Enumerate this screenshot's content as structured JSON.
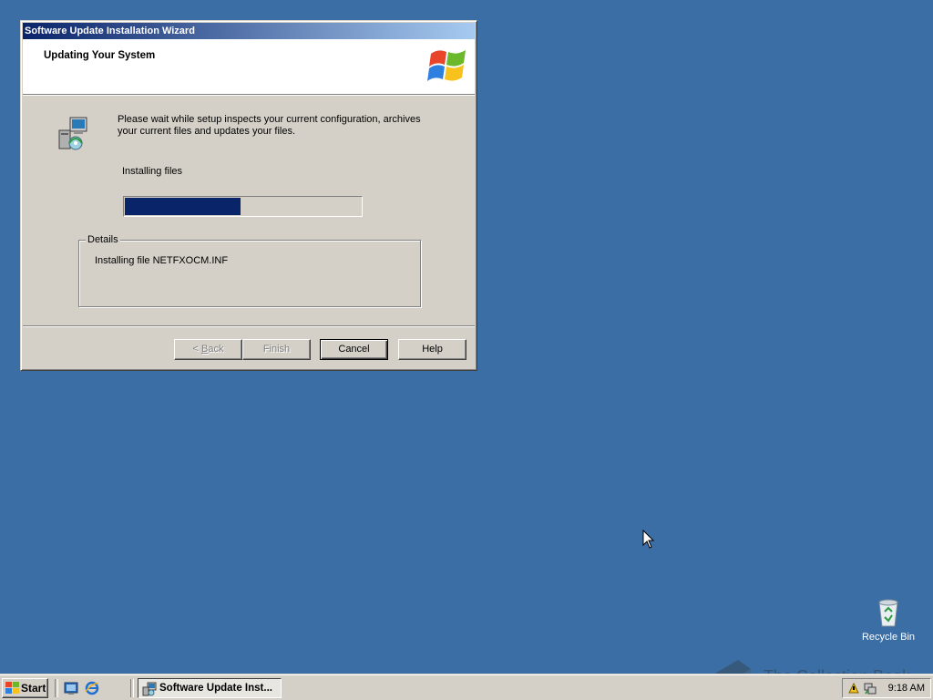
{
  "window": {
    "title": "Software Update Installation Wizard",
    "header_title": "Updating Your System",
    "intro_text": "Please wait while setup inspects your current configuration, archives your current files and updates your files.",
    "status_label": "Installing files",
    "progress_percent": 49,
    "details": {
      "legend": "Details",
      "text": "Installing file NETFXOCM.INF"
    },
    "buttons": {
      "back_label": "< Back",
      "back_mnemonic_prefix": "< ",
      "back_mnemonic_char": "B",
      "back_mnemonic_rest": "ack",
      "finish_label": "Finish",
      "cancel_label": "Cancel",
      "help_label": "Help"
    }
  },
  "desktop": {
    "recycle_bin_label": "Recycle Bin",
    "background_color": "#3a6ea5"
  },
  "taskbar": {
    "start_label": "Start",
    "task_button_label": "Software Update Inst...",
    "clock": "9:18 AM",
    "quick_launch": [
      "show-desktop-icon",
      "internet-explorer-icon"
    ],
    "tray_icons": [
      "security-tray-icon",
      "network-tray-icon"
    ]
  },
  "watermark": {
    "text": "The Collection Book"
  },
  "colors": {
    "titlebar_start": "#0a246a",
    "titlebar_end": "#a6caf0",
    "progress_fill": "#0a246a",
    "face": "#d4d0c8"
  }
}
